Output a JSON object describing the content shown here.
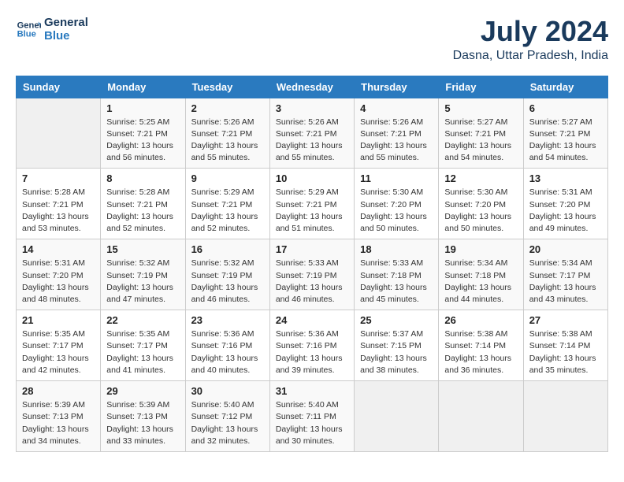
{
  "logo": {
    "line1": "General",
    "line2": "Blue"
  },
  "title": "July 2024",
  "location": "Dasna, Uttar Pradesh, India",
  "headers": [
    "Sunday",
    "Monday",
    "Tuesday",
    "Wednesday",
    "Thursday",
    "Friday",
    "Saturday"
  ],
  "weeks": [
    [
      {
        "day": "",
        "info": ""
      },
      {
        "day": "1",
        "info": "Sunrise: 5:25 AM\nSunset: 7:21 PM\nDaylight: 13 hours\nand 56 minutes."
      },
      {
        "day": "2",
        "info": "Sunrise: 5:26 AM\nSunset: 7:21 PM\nDaylight: 13 hours\nand 55 minutes."
      },
      {
        "day": "3",
        "info": "Sunrise: 5:26 AM\nSunset: 7:21 PM\nDaylight: 13 hours\nand 55 minutes."
      },
      {
        "day": "4",
        "info": "Sunrise: 5:26 AM\nSunset: 7:21 PM\nDaylight: 13 hours\nand 55 minutes."
      },
      {
        "day": "5",
        "info": "Sunrise: 5:27 AM\nSunset: 7:21 PM\nDaylight: 13 hours\nand 54 minutes."
      },
      {
        "day": "6",
        "info": "Sunrise: 5:27 AM\nSunset: 7:21 PM\nDaylight: 13 hours\nand 54 minutes."
      }
    ],
    [
      {
        "day": "7",
        "info": "Sunrise: 5:28 AM\nSunset: 7:21 PM\nDaylight: 13 hours\nand 53 minutes."
      },
      {
        "day": "8",
        "info": "Sunrise: 5:28 AM\nSunset: 7:21 PM\nDaylight: 13 hours\nand 52 minutes."
      },
      {
        "day": "9",
        "info": "Sunrise: 5:29 AM\nSunset: 7:21 PM\nDaylight: 13 hours\nand 52 minutes."
      },
      {
        "day": "10",
        "info": "Sunrise: 5:29 AM\nSunset: 7:21 PM\nDaylight: 13 hours\nand 51 minutes."
      },
      {
        "day": "11",
        "info": "Sunrise: 5:30 AM\nSunset: 7:20 PM\nDaylight: 13 hours\nand 50 minutes."
      },
      {
        "day": "12",
        "info": "Sunrise: 5:30 AM\nSunset: 7:20 PM\nDaylight: 13 hours\nand 50 minutes."
      },
      {
        "day": "13",
        "info": "Sunrise: 5:31 AM\nSunset: 7:20 PM\nDaylight: 13 hours\nand 49 minutes."
      }
    ],
    [
      {
        "day": "14",
        "info": "Sunrise: 5:31 AM\nSunset: 7:20 PM\nDaylight: 13 hours\nand 48 minutes."
      },
      {
        "day": "15",
        "info": "Sunrise: 5:32 AM\nSunset: 7:19 PM\nDaylight: 13 hours\nand 47 minutes."
      },
      {
        "day": "16",
        "info": "Sunrise: 5:32 AM\nSunset: 7:19 PM\nDaylight: 13 hours\nand 46 minutes."
      },
      {
        "day": "17",
        "info": "Sunrise: 5:33 AM\nSunset: 7:19 PM\nDaylight: 13 hours\nand 46 minutes."
      },
      {
        "day": "18",
        "info": "Sunrise: 5:33 AM\nSunset: 7:18 PM\nDaylight: 13 hours\nand 45 minutes."
      },
      {
        "day": "19",
        "info": "Sunrise: 5:34 AM\nSunset: 7:18 PM\nDaylight: 13 hours\nand 44 minutes."
      },
      {
        "day": "20",
        "info": "Sunrise: 5:34 AM\nSunset: 7:17 PM\nDaylight: 13 hours\nand 43 minutes."
      }
    ],
    [
      {
        "day": "21",
        "info": "Sunrise: 5:35 AM\nSunset: 7:17 PM\nDaylight: 13 hours\nand 42 minutes."
      },
      {
        "day": "22",
        "info": "Sunrise: 5:35 AM\nSunset: 7:17 PM\nDaylight: 13 hours\nand 41 minutes."
      },
      {
        "day": "23",
        "info": "Sunrise: 5:36 AM\nSunset: 7:16 PM\nDaylight: 13 hours\nand 40 minutes."
      },
      {
        "day": "24",
        "info": "Sunrise: 5:36 AM\nSunset: 7:16 PM\nDaylight: 13 hours\nand 39 minutes."
      },
      {
        "day": "25",
        "info": "Sunrise: 5:37 AM\nSunset: 7:15 PM\nDaylight: 13 hours\nand 38 minutes."
      },
      {
        "day": "26",
        "info": "Sunrise: 5:38 AM\nSunset: 7:14 PM\nDaylight: 13 hours\nand 36 minutes."
      },
      {
        "day": "27",
        "info": "Sunrise: 5:38 AM\nSunset: 7:14 PM\nDaylight: 13 hours\nand 35 minutes."
      }
    ],
    [
      {
        "day": "28",
        "info": "Sunrise: 5:39 AM\nSunset: 7:13 PM\nDaylight: 13 hours\nand 34 minutes."
      },
      {
        "day": "29",
        "info": "Sunrise: 5:39 AM\nSunset: 7:13 PM\nDaylight: 13 hours\nand 33 minutes."
      },
      {
        "day": "30",
        "info": "Sunrise: 5:40 AM\nSunset: 7:12 PM\nDaylight: 13 hours\nand 32 minutes."
      },
      {
        "day": "31",
        "info": "Sunrise: 5:40 AM\nSunset: 7:11 PM\nDaylight: 13 hours\nand 30 minutes."
      },
      {
        "day": "",
        "info": ""
      },
      {
        "day": "",
        "info": ""
      },
      {
        "day": "",
        "info": ""
      }
    ]
  ]
}
